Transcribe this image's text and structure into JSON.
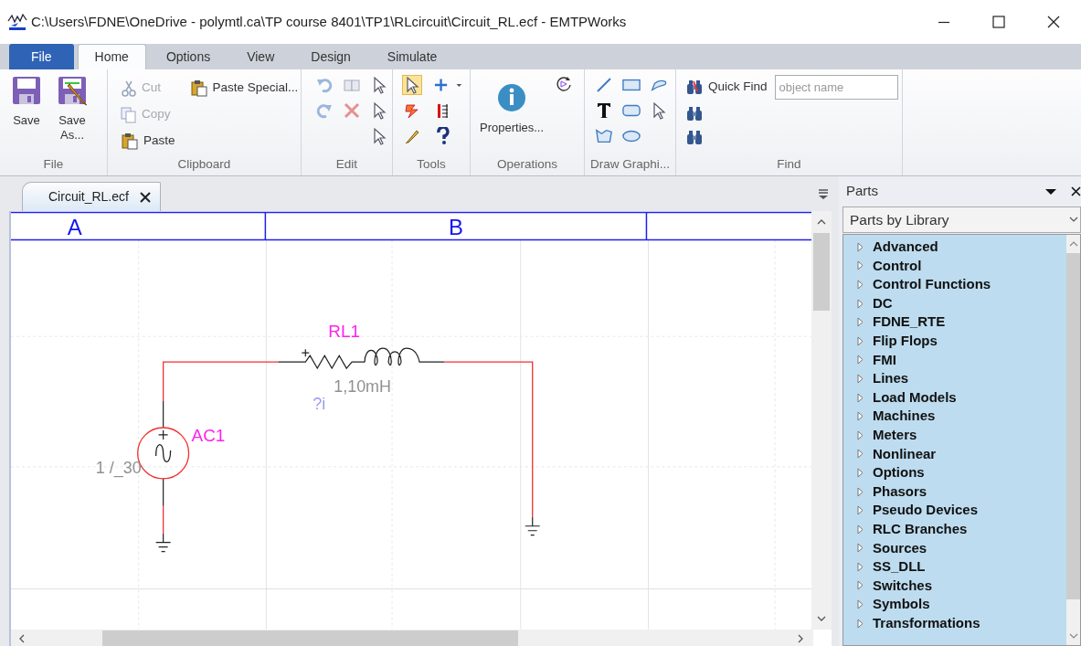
{
  "window": {
    "title": "C:\\Users\\FDNE\\OneDrive - polymtl.ca\\TP course 8401\\TP1\\RLcircuit\\Circuit_RL.ecf - EMTPWorks"
  },
  "menu_tabs": [
    {
      "label": "File",
      "kind": "file",
      "selected": false
    },
    {
      "label": "Home",
      "kind": "tab",
      "selected": true
    },
    {
      "label": "Options",
      "kind": "tab",
      "selected": false
    },
    {
      "label": "View",
      "kind": "tab",
      "selected": false
    },
    {
      "label": "Design",
      "kind": "tab",
      "selected": false
    },
    {
      "label": "Simulate",
      "kind": "tab",
      "selected": false
    }
  ],
  "ribbon": {
    "groups": [
      {
        "kind": "file",
        "label": "File",
        "buttons": [
          {
            "label": "Save"
          },
          {
            "label": "Save As..."
          }
        ]
      },
      {
        "kind": "clipboard",
        "label": "Clipboard",
        "buttons": [
          {
            "label": "Cut",
            "disabled": true
          },
          {
            "label": "Copy",
            "disabled": true
          },
          {
            "label": "Paste",
            "disabled": false
          },
          {
            "label": "Paste Special...",
            "disabled": false
          }
        ]
      },
      {
        "kind": "edit",
        "label": "Edit"
      },
      {
        "kind": "tools",
        "label": "Tools",
        "select_tool": {
          "selected": true
        }
      },
      {
        "kind": "operations",
        "label": "Operations",
        "buttons": [
          {
            "label": "Properties..."
          }
        ]
      },
      {
        "kind": "draw",
        "label": "Draw Graphi..."
      },
      {
        "kind": "find",
        "label": "Find",
        "quick_find": "Quick Find",
        "placeholder": "object name"
      }
    ]
  },
  "document_tabs": [
    {
      "label": "Circuit_RL.ecf",
      "selected": true
    }
  ],
  "schematic": {
    "columns": [
      "A",
      "B"
    ],
    "rl_branch": {
      "name": "RL1",
      "value": "1,10mH",
      "probe": "?i"
    },
    "source": {
      "name": "AC1",
      "value": "1 /_30"
    }
  },
  "parts_panel": {
    "title": "Parts",
    "view": "Parts by Library",
    "libraries": [
      {
        "label": "Advanced",
        "expanded": false
      },
      {
        "label": "Control",
        "expanded": false
      },
      {
        "label": "Control Functions",
        "expanded": false
      },
      {
        "label": "DC",
        "expanded": false
      },
      {
        "label": "FDNE_RTE",
        "expanded": false
      },
      {
        "label": "Flip Flops",
        "expanded": false
      },
      {
        "label": "FMI",
        "expanded": false
      },
      {
        "label": "Lines",
        "expanded": false
      },
      {
        "label": "Load Models",
        "expanded": false
      },
      {
        "label": "Machines",
        "expanded": false
      },
      {
        "label": "Meters",
        "expanded": false
      },
      {
        "label": "Nonlinear",
        "expanded": false
      },
      {
        "label": "Options",
        "expanded": false
      },
      {
        "label": "Phasors",
        "expanded": false
      },
      {
        "label": "Pseudo Devices",
        "expanded": false
      },
      {
        "label": "RLC Branches",
        "expanded": false
      },
      {
        "label": "Sources",
        "expanded": false
      },
      {
        "label": "SS_DLL",
        "expanded": false
      },
      {
        "label": "Switches",
        "expanded": false
      },
      {
        "label": "Symbols",
        "expanded": false
      },
      {
        "label": "Transformations",
        "expanded": false
      }
    ]
  }
}
